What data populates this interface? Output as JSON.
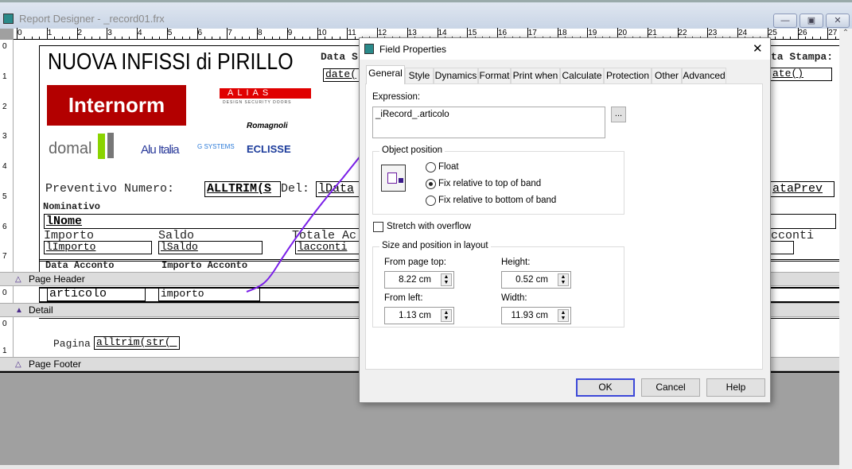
{
  "window": {
    "title": "Report Designer - _record01.frx",
    "minimize": "—",
    "restore": "▣",
    "close": "✕"
  },
  "ruler": {
    "h": [
      "0",
      "1",
      "2",
      "3",
      "4",
      "5",
      "6",
      "7",
      "8",
      "9",
      "10",
      "11",
      "12",
      "13",
      "14",
      "15",
      "16",
      "17",
      "18",
      "19",
      "20",
      "21",
      "22",
      "23",
      "24",
      "25",
      "26",
      "27"
    ],
    "v_header": [
      "0",
      "1",
      "2",
      "3",
      "4",
      "5",
      "6",
      "7"
    ],
    "v_detail": "0",
    "v_footer": [
      "0",
      "1"
    ]
  },
  "report": {
    "company": "NUOVA INFISSI di PIRILLO",
    "logos": {
      "internorm": "Internorm",
      "alias": "ALIAS",
      "alias_sub": "DESIGN SECURITY DOORS",
      "romagnoli": "Romagnoli",
      "domal": "domal",
      "aluitalia": "Alu Italia",
      "gsystems": "G SYSTEMS",
      "eclisse": "ECLISSE"
    },
    "data_label": "Data S",
    "date_field": "date(",
    "data_stampa_label": "ta Stampa:",
    "date_field2": "ate()",
    "preventivo_label": "Preventivo Numero:",
    "preventivo_field": "ALLTRIM(S",
    "del_label": "Del:",
    "data_field": "lData",
    "dataprev_field": "ataPrev",
    "nominativo_label": "Nominativo",
    "nome_field": "lNome",
    "importo_label": "Importo",
    "saldo_label": "Saldo",
    "totale_label": "Totale Ac",
    "acconti_label": "cconti",
    "importo_field": "lImporto",
    "saldo_field": "lSaldo",
    "acconti_field": "lacconti",
    "data_acconto_label": "Data Acconto",
    "importo_acconto_label": "Importo Acconto",
    "detail_articolo": "articolo",
    "detail_importo": "importo",
    "pagina_label": "Pagina",
    "pagina_field": "alltrim(str(_"
  },
  "bands": {
    "page_header": "Page Header",
    "detail": "Detail",
    "page_footer": "Page Footer"
  },
  "dialog": {
    "title": "Field Properties",
    "close": "✕",
    "tabs": [
      "General",
      "Style",
      "Dynamics",
      "Format",
      "Print when",
      "Calculate",
      "Protection",
      "Other",
      "Advanced"
    ],
    "active_tab": "General",
    "expression_label": "Expression:",
    "expression_value": "_iRecord_.articolo",
    "builder_button": "...",
    "object_position_label": "Object position",
    "positions": [
      "Float",
      "Fix relative to top of band",
      "Fix relative to bottom of band"
    ],
    "selected_position": "Fix relative to top of band",
    "stretch_label": "Stretch with overflow",
    "stretch_checked": false,
    "size_group_label": "Size and position in layout",
    "from_top_label": "From page top:",
    "from_top": "8.22 cm",
    "height_label": "Height:",
    "height": "0.52 cm",
    "from_left_label": "From left:",
    "from_left": "1.13 cm",
    "width_label": "Width:",
    "width": "11.93 cm",
    "ok": "OK",
    "cancel": "Cancel",
    "help": "Help"
  },
  "colors": {
    "annotation": "#7a1ee8",
    "internorm": "#b30000",
    "alias": "#e00000",
    "default_button_border": "#3c48d8"
  }
}
